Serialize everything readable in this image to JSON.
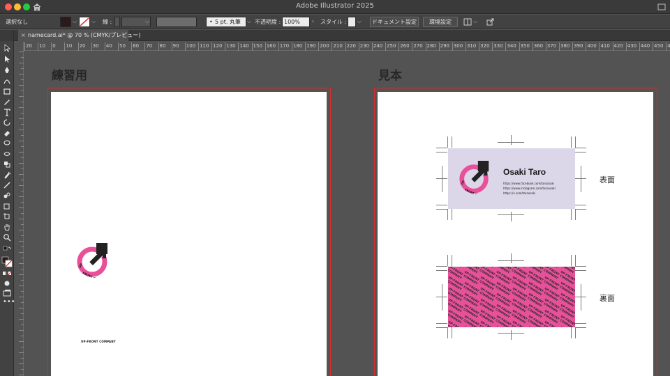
{
  "app": {
    "title": "Adobe Illustrator 2025"
  },
  "controlbar": {
    "selection": "選択なし",
    "stroke_label": "線 :",
    "brush_value": "5 pt. 丸筆",
    "opacity_label": "不透明度 :",
    "opacity_value": "100%",
    "style_label": "スタイル :",
    "doc_setup_button": "ドキュメント設定",
    "prefs_button": "環境設定"
  },
  "document_tab": {
    "close": "×",
    "label": "namecard.ai* @ 70 % (CMYK/プレビュー)"
  },
  "ruler": {
    "ticks": [
      "20",
      "10",
      "0",
      "10",
      "20",
      "30",
      "40",
      "50",
      "60",
      "70",
      "80",
      "90",
      "100",
      "110",
      "120",
      "130",
      "140",
      "150",
      "160",
      "170",
      "180",
      "190",
      "200",
      "210",
      "220",
      "230",
      "240",
      "250",
      "260",
      "270",
      "280",
      "290",
      "300",
      "310",
      "320",
      "330",
      "340",
      "350",
      "360",
      "370",
      "380",
      "390",
      "400",
      "410",
      "420",
      "430",
      "440",
      "450",
      "460"
    ]
  },
  "artboards": {
    "practice_title": "練習用",
    "sample_title": "見本"
  },
  "logo": {
    "ring_text": "UP FRONT COMPANY",
    "wordmark": "UP-FRONT COMPANY"
  },
  "card": {
    "name": "Osaki Taro",
    "urls": [
      "https://www.facebook.com/taroosaki",
      "https://www.instagram.com/taroosaki",
      "https://x.com/taroosaki"
    ],
    "front_label": "表面",
    "back_label": "裏面",
    "pattern_text": "UP-FRONT COMPANY"
  },
  "colors": {
    "brand_pink": "#e8509a",
    "card_front_bg": "#dbd7e8",
    "bleed_red": "#d92c2c",
    "ui_dark": "#424242"
  }
}
